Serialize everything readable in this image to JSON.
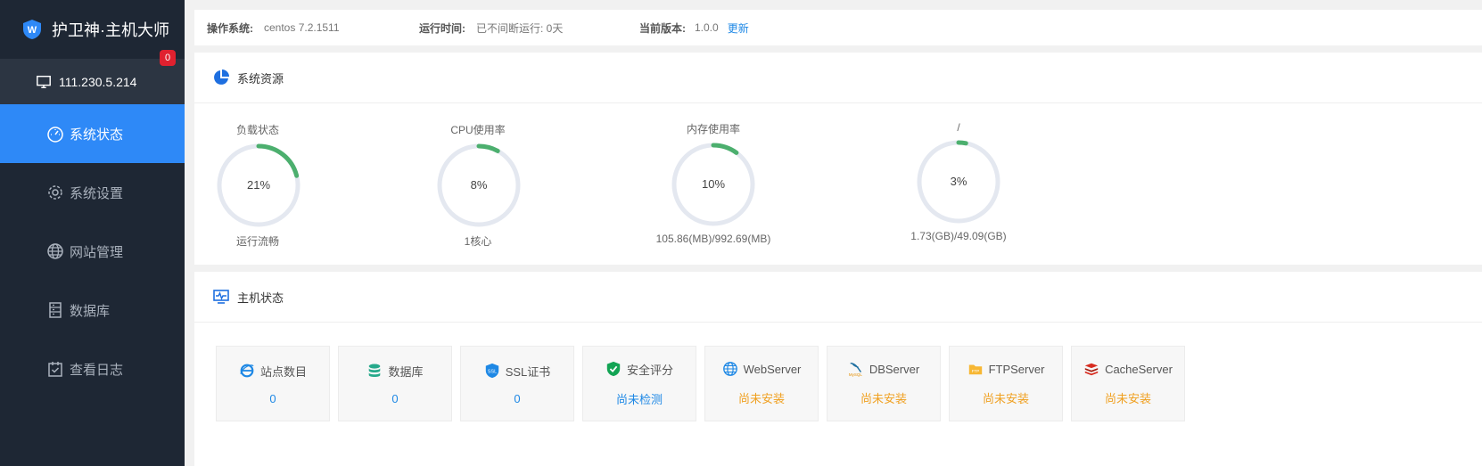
{
  "app": {
    "title": "护卫神·主机大师"
  },
  "server": {
    "ip": "111.230.5.214",
    "badge": "0"
  },
  "nav": {
    "items": [
      {
        "label": "系统状态",
        "icon": "dashboard-icon",
        "active": true
      },
      {
        "label": "系统设置",
        "icon": "gear-icon"
      },
      {
        "label": "网站管理",
        "icon": "globe-icon"
      },
      {
        "label": "数据库",
        "icon": "database-icon"
      },
      {
        "label": "查看日志",
        "icon": "calendar-icon"
      }
    ]
  },
  "topbar": {
    "os_label": "操作系统:",
    "os_value": "centos 7.2.1511",
    "uptime_label": "运行时间:",
    "uptime_value": "已不间断运行: 0天",
    "version_label": "当前版本:",
    "version_value": "1.0.0",
    "update_label": "更新"
  },
  "resources": {
    "title": "系统资源",
    "gauges": [
      {
        "label": "负载状态",
        "value_text": "21%",
        "percent": 21,
        "sub": "运行流畅"
      },
      {
        "label": "CPU使用率",
        "value_text": "8%",
        "percent": 8,
        "sub": "1核心"
      },
      {
        "label": "内存使用率",
        "value_text": "10%",
        "percent": 10,
        "sub": "105.86(MB)/992.69(MB)"
      },
      {
        "label": "/",
        "value_text": "3%",
        "percent": 3,
        "sub": "1.73(GB)/49.09(GB)"
      }
    ],
    "colors": {
      "track": "#e4e8f0",
      "arc": "#4caf6e"
    }
  },
  "host": {
    "title": "主机状态",
    "cards": [
      {
        "label": "站点数目",
        "value": "0",
        "icon": "ie-icon",
        "tone": "blue"
      },
      {
        "label": "数据库",
        "value": "0",
        "icon": "database-icon",
        "tone": "blue"
      },
      {
        "label": "SSL证书",
        "value": "0",
        "icon": "ssl-icon",
        "tone": "blue"
      },
      {
        "label": "安全评分",
        "value": "尚未检测",
        "icon": "shield-icon",
        "tone": "blue"
      },
      {
        "label": "WebServer",
        "value": "尚未安装",
        "icon": "globe-icon",
        "tone": "orange"
      },
      {
        "label": "DBServer",
        "value": "尚未安装",
        "icon": "mysql-icon",
        "tone": "orange"
      },
      {
        "label": "FTPServer",
        "value": "尚未安装",
        "icon": "ftp-icon",
        "tone": "orange"
      },
      {
        "label": "CacheServer",
        "value": "尚未安装",
        "icon": "redis-icon",
        "tone": "orange"
      }
    ]
  }
}
